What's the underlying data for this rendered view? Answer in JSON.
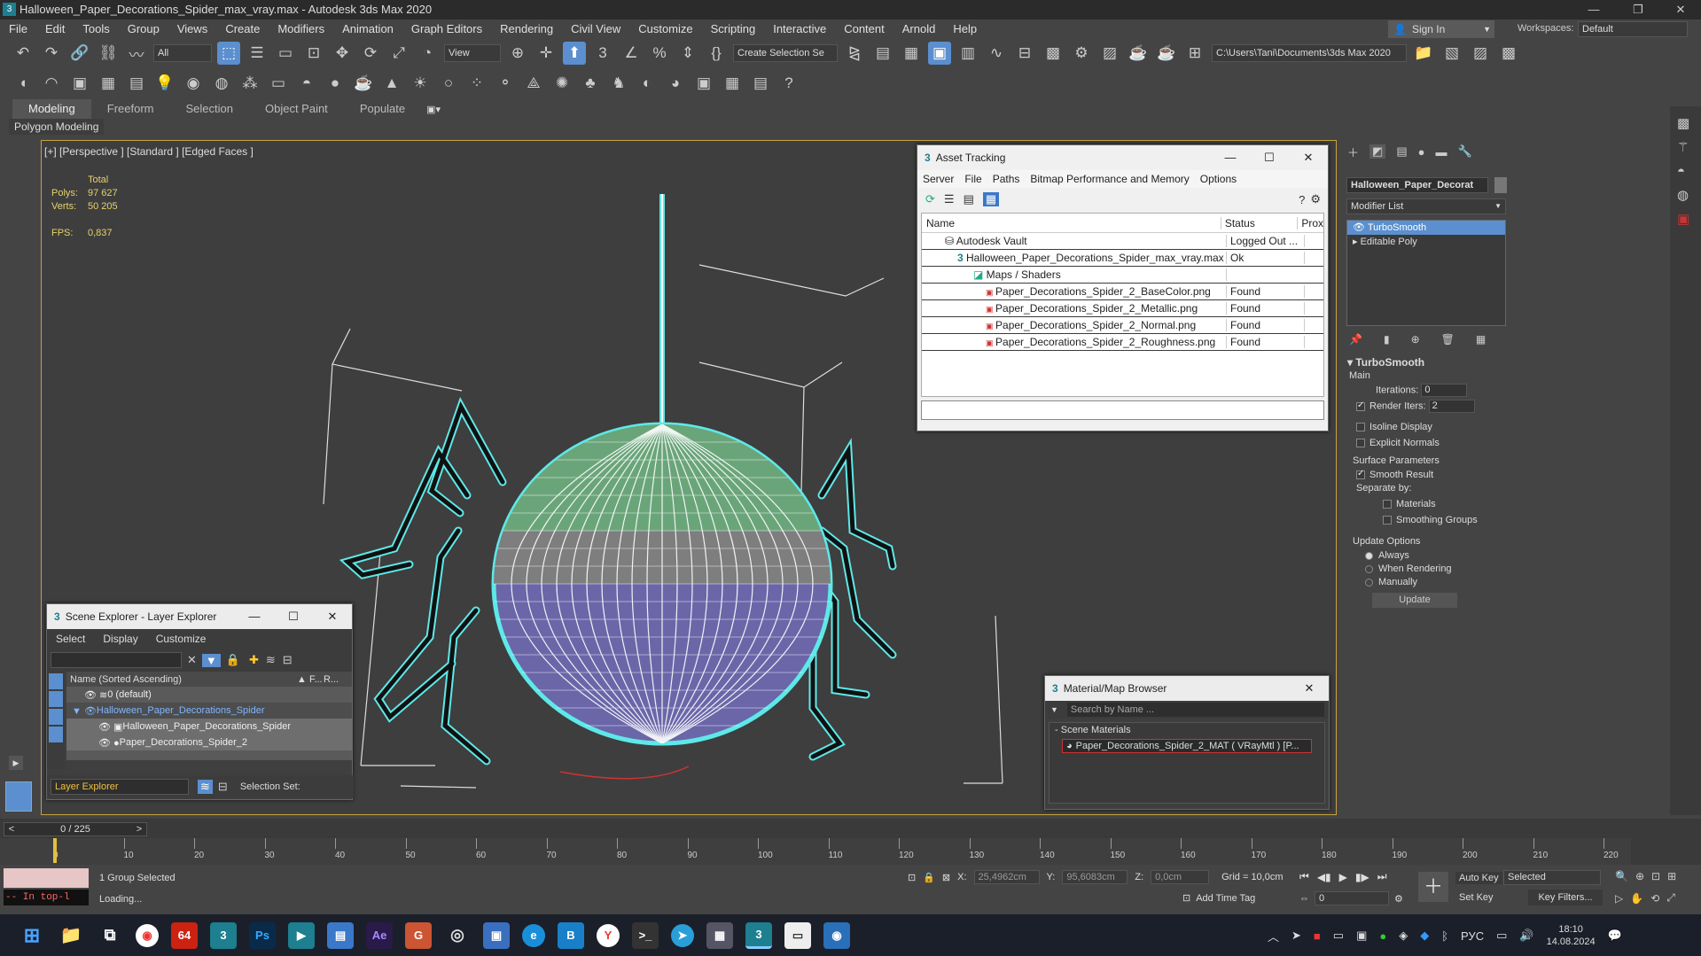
{
  "window": {
    "title": "Halloween_Paper_Decorations_Spider_max_vray.max - Autodesk 3ds Max 2020"
  },
  "menu": [
    "File",
    "Edit",
    "Tools",
    "Group",
    "Views",
    "Create",
    "Modifiers",
    "Animation",
    "Graph Editors",
    "Rendering",
    "Civil View",
    "Customize",
    "Scripting",
    "Interactive",
    "Content",
    "Arnold",
    "Help"
  ],
  "signin": {
    "label": "Sign In",
    "workspaces_label": "Workspaces:",
    "workspace_value": "Default"
  },
  "toolbar": {
    "filter_value": "All",
    "view_value": "View",
    "selection_set": "Create Selection Se",
    "project_path": "C:\\Users\\Tani\\Documents\\3ds Max 2020"
  },
  "ribbon": {
    "tabs": [
      "Modeling",
      "Freeform",
      "Selection",
      "Object Paint",
      "Populate"
    ],
    "sub_label": "Polygon Modeling"
  },
  "viewport": {
    "label": "[+] [Perspective ] [Standard ] [Edged Faces ]",
    "stats": {
      "total": "Total",
      "polys_label": "Polys:",
      "polys": "97 627",
      "verts_label": "Verts:",
      "verts": "50 205",
      "fps_label": "FPS:",
      "fps": "0,837"
    }
  },
  "asset_tracking": {
    "title": "Asset Tracking",
    "menus": [
      "Server",
      "File",
      "Paths",
      "Bitmap Performance and Memory",
      "Options"
    ],
    "headers": [
      "Name",
      "Status",
      "Prox"
    ],
    "rows": [
      {
        "name": "Autodesk Vault",
        "status": "Logged Out ..."
      },
      {
        "name": "Halloween_Paper_Decorations_Spider_max_vray.max",
        "status": "Ok"
      },
      {
        "name": "Maps / Shaders",
        "status": ""
      },
      {
        "name": "Paper_Decorations_Spider_2_BaseColor.png",
        "status": "Found"
      },
      {
        "name": "Paper_Decorations_Spider_2_Metallic.png",
        "status": "Found"
      },
      {
        "name": "Paper_Decorations_Spider_2_Normal.png",
        "status": "Found"
      },
      {
        "name": "Paper_Decorations_Spider_2_Roughness.png",
        "status": "Found"
      }
    ]
  },
  "scene_explorer": {
    "title": "Scene Explorer - Layer Explorer",
    "menus": [
      "Select",
      "Display",
      "Customize"
    ],
    "header_name": "Name (Sorted Ascending)",
    "header_f": "▲ F...",
    "header_r": "R...",
    "rows": [
      "0 (default)",
      "Halloween_Paper_Decorations_Spider",
      "Halloween_Paper_Decorations_Spider",
      "Paper_Decorations_Spider_2"
    ],
    "footer_dropdown": "Layer Explorer",
    "footer_label": "Selection Set:"
  },
  "material_browser": {
    "title": "Material/Map Browser",
    "search_placeholder": "Search by Name ...",
    "section": "Scene Materials",
    "item": "Paper_Decorations_Spider_2_MAT  ( VRayMtl ) [P..."
  },
  "command_panel": {
    "object_name": "Halloween_Paper_Decorat",
    "modifier_list": "Modifier List",
    "stack": [
      "TurboSmooth",
      "Editable Poly"
    ],
    "rollout_title": "TurboSmooth",
    "main_label": "Main",
    "iterations_label": "Iterations:",
    "iterations": "0",
    "render_iters_label": "Render Iters:",
    "render_iters": "2",
    "isoline": "Isoline Display",
    "explicit": "Explicit Normals",
    "surface_label": "Surface Parameters",
    "smooth_result": "Smooth Result",
    "separate_by": "Separate by:",
    "materials": "Materials",
    "smoothing_groups": "Smoothing Groups",
    "update_options": "Update Options",
    "always": "Always",
    "when_rendering": "When Rendering",
    "manually": "Manually",
    "update_btn": "Update"
  },
  "timeline": {
    "frame": "0 / 225",
    "ticks": [
      "0",
      "10",
      "20",
      "30",
      "40",
      "50",
      "60",
      "70",
      "80",
      "90",
      "100",
      "110",
      "120",
      "130",
      "140",
      "150",
      "160",
      "170",
      "180",
      "190",
      "200",
      "210",
      "220"
    ]
  },
  "status": {
    "selected": "1 Group Selected",
    "loading": "Loading...",
    "script": "-- In top-l",
    "x_label": "X:",
    "x": "25,4962cm",
    "y_label": "Y:",
    "y": "95,6083cm",
    "z_label": "Z:",
    "z": "0,0cm",
    "grid": "Grid = 10,0cm",
    "add_time_tag": "Add Time Tag",
    "auto_key": "Auto Key",
    "selected_dd": "Selected",
    "set_key": "Set Key",
    "key_filters": "Key Filters...",
    "frame_field": "0"
  },
  "taskbar": {
    "lang": "РУС",
    "time": "18:10",
    "date": "14.08.2024",
    "apps": [
      "start",
      "explorer",
      "taskview",
      "chrome",
      "64",
      "3dsmax",
      "photoshop",
      "app",
      "notepad",
      "after-effects",
      "app-g",
      "obs",
      "save",
      "edge",
      "b",
      "yandex",
      "terminal",
      "telegram",
      "calculator",
      "3dsmax-active",
      "file",
      "camera"
    ]
  },
  "colors": {
    "accent": "#5b8fcf",
    "wire": "#5ee8e8",
    "viewport_border": "#c9a33e",
    "stats": "#e8d26a"
  }
}
